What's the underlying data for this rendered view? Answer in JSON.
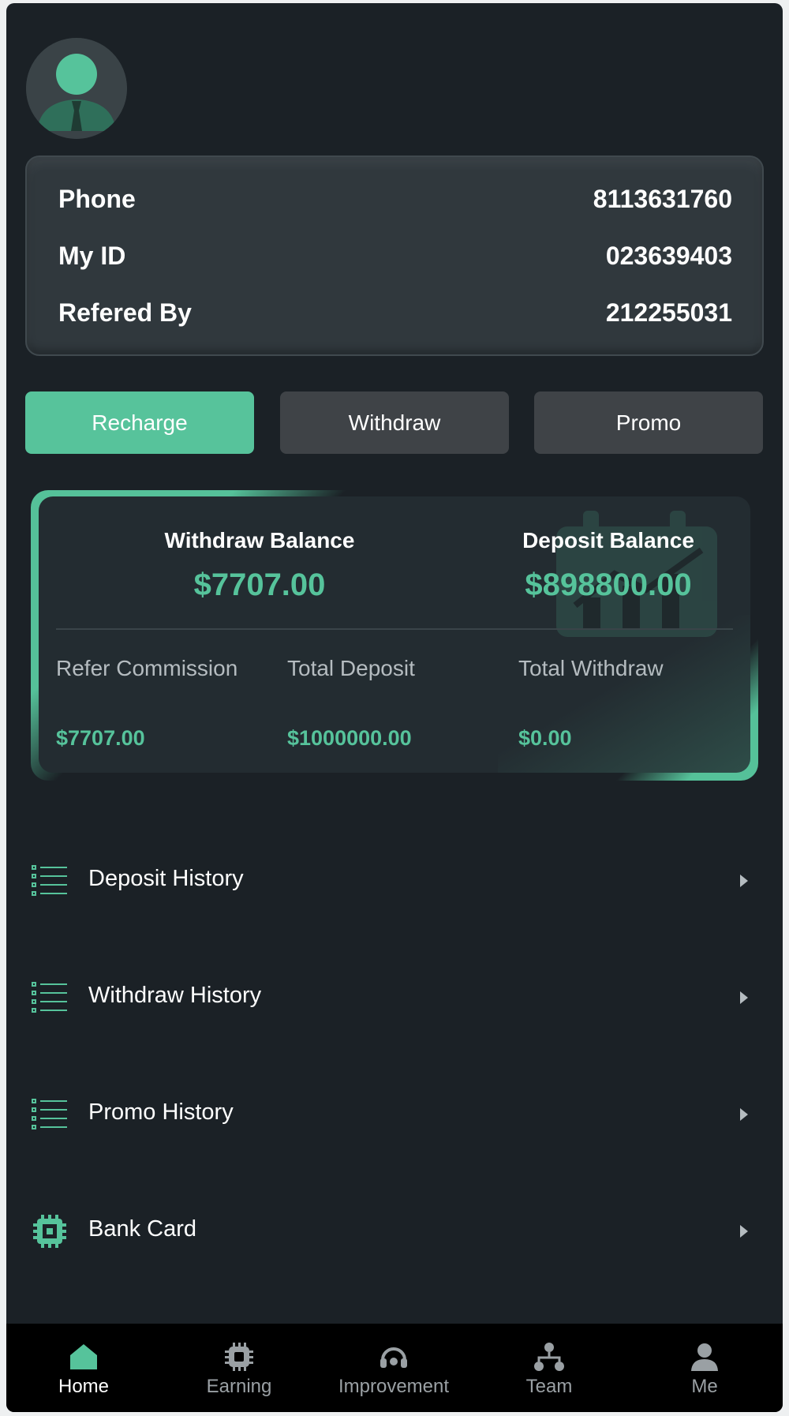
{
  "profile": {
    "avatar_icon": "user-avatar-icon",
    "rows": [
      {
        "label": "Phone",
        "value": "8113631760"
      },
      {
        "label": "My ID",
        "value": "023639403"
      },
      {
        "label": "Refered By",
        "value": "212255031"
      }
    ]
  },
  "actions": {
    "recharge": "Recharge",
    "withdraw": "Withdraw",
    "promo": "Promo"
  },
  "balances": {
    "withdraw_title": "Withdraw Balance",
    "withdraw_value": "$7707.00",
    "deposit_title": "Deposit Balance",
    "deposit_value": "$898800.00",
    "stats": [
      {
        "label": "Refer Commission",
        "value": "$7707.00"
      },
      {
        "label": "Total Deposit",
        "value": "$1000000.00"
      },
      {
        "label": "Total Withdraw",
        "value": "$0.00"
      }
    ]
  },
  "menu": [
    {
      "label": "Deposit History",
      "icon": "list-icon"
    },
    {
      "label": "Withdraw History",
      "icon": "list-icon"
    },
    {
      "label": "Promo History",
      "icon": "list-icon"
    },
    {
      "label": "Bank Card",
      "icon": "chip-icon"
    }
  ],
  "tabbar": [
    {
      "label": "Home",
      "icon": "home-icon",
      "active": true
    },
    {
      "label": "Earning",
      "icon": "chip-icon",
      "active": false
    },
    {
      "label": "Improvement",
      "icon": "headset-icon",
      "active": false
    },
    {
      "label": "Team",
      "icon": "team-icon",
      "active": false
    },
    {
      "label": "Me",
      "icon": "person-icon",
      "active": false
    }
  ],
  "colors": {
    "background": "#1b2126",
    "accent": "#56c39b",
    "card": "#30383d",
    "button": "#3f4347",
    "tabbar": "#000000"
  }
}
